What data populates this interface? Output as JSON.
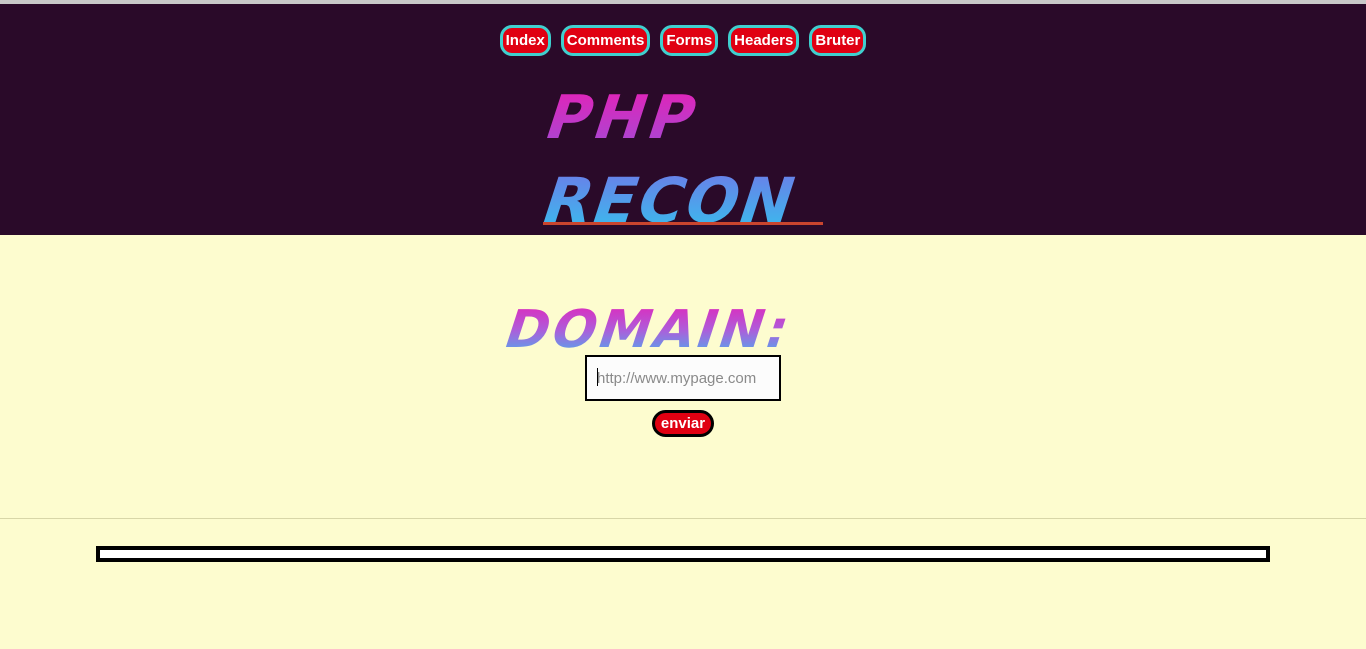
{
  "nav": {
    "items": [
      {
        "label": "Index"
      },
      {
        "label": "Comments"
      },
      {
        "label": "Forms"
      },
      {
        "label": "Headers"
      },
      {
        "label": "Bruter"
      }
    ]
  },
  "logo": {
    "line1": "PHP",
    "line2": "RECON"
  },
  "form": {
    "label": "DOMAIN:",
    "input_value": "",
    "input_placeholder": "http://www.mypage.com",
    "submit_label": "enviar"
  },
  "colors": {
    "header_bg": "#2a0a29",
    "page_bg": "#fdfccf",
    "button_red": "#e00012",
    "nav_border": "#3fd0cf",
    "gradient_pink": "#e020b8",
    "gradient_blue": "#3fb8f0"
  }
}
